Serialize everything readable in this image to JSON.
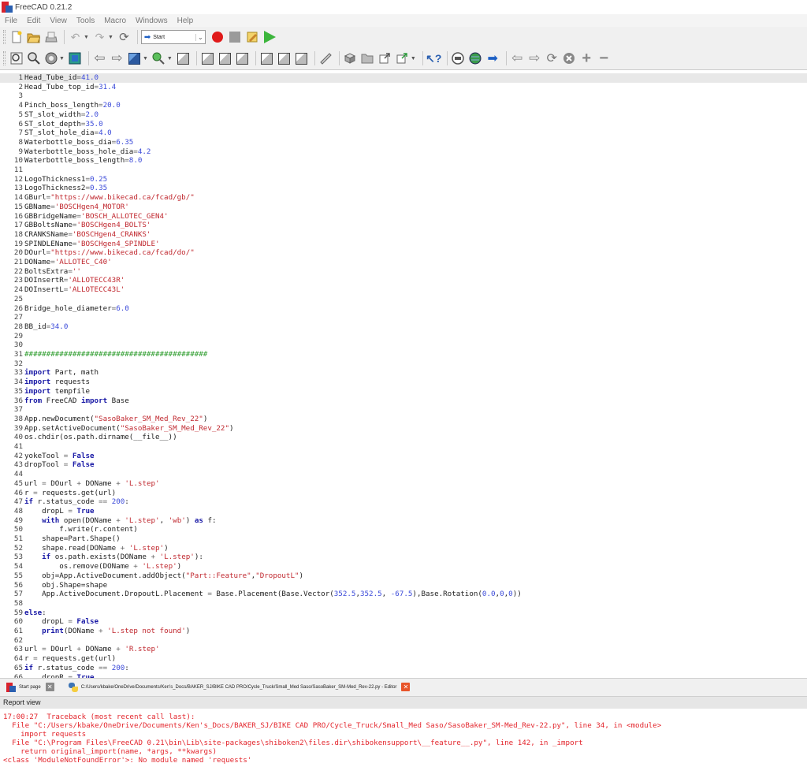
{
  "window": {
    "title": "FreeCAD 0.21.2"
  },
  "menu": [
    "File",
    "Edit",
    "View",
    "Tools",
    "Macro",
    "Windows",
    "Help"
  ],
  "workbench": {
    "selected": "Start"
  },
  "editor": {
    "current_line": 1,
    "lines": [
      [
        [
          "Head_Tube_id",
          ""
        ],
        [
          "=",
          "op"
        ],
        [
          "41.0",
          "num"
        ]
      ],
      [
        [
          "Head_Tube_top_id",
          ""
        ],
        [
          "=",
          "op"
        ],
        [
          "31.4",
          "num"
        ]
      ],
      [],
      [
        [
          "Pinch_boss_length",
          ""
        ],
        [
          "=",
          "op"
        ],
        [
          "20.0",
          "num"
        ]
      ],
      [
        [
          "ST_slot_width",
          ""
        ],
        [
          "=",
          "op"
        ],
        [
          "2.0",
          "num"
        ]
      ],
      [
        [
          "ST_slot_depth",
          ""
        ],
        [
          "=",
          "op"
        ],
        [
          "35.0",
          "num"
        ]
      ],
      [
        [
          "ST_slot_hole_dia",
          ""
        ],
        [
          "=",
          "op"
        ],
        [
          "4.0",
          "num"
        ]
      ],
      [
        [
          "Waterbottle_boss_dia",
          ""
        ],
        [
          "=",
          "op"
        ],
        [
          "6.35",
          "num"
        ]
      ],
      [
        [
          "Waterbottle_boss_hole_dia",
          ""
        ],
        [
          "=",
          "op"
        ],
        [
          "4.2",
          "num"
        ]
      ],
      [
        [
          "Waterbottle_boss_length",
          ""
        ],
        [
          "=",
          "op"
        ],
        [
          "8.0",
          "num"
        ]
      ],
      [],
      [
        [
          "LogoThickness1",
          ""
        ],
        [
          "=",
          "op"
        ],
        [
          "0.25",
          "num"
        ]
      ],
      [
        [
          "LogoThickness2",
          ""
        ],
        [
          "=",
          "op"
        ],
        [
          "0.35",
          "num"
        ]
      ],
      [
        [
          "GBurl",
          ""
        ],
        [
          "=",
          "op"
        ],
        [
          "\"https://www.bikecad.ca/fcad/gb/\"",
          "str"
        ]
      ],
      [
        [
          "GBName",
          ""
        ],
        [
          "=",
          "op"
        ],
        [
          "'BOSCHgen4_MOTOR'",
          "str"
        ]
      ],
      [
        [
          "GBBridgeName",
          ""
        ],
        [
          "=",
          "op"
        ],
        [
          "'BOSCH_ALLOTEC_GEN4'",
          "str"
        ]
      ],
      [
        [
          "GBBoltsName",
          ""
        ],
        [
          "=",
          "op"
        ],
        [
          "'BOSCHgen4_BOLTS'",
          "str"
        ]
      ],
      [
        [
          "CRANKSName",
          ""
        ],
        [
          "=",
          "op"
        ],
        [
          "'BOSCHgen4_CRANKS'",
          "str"
        ]
      ],
      [
        [
          "SPINDLEName",
          ""
        ],
        [
          "=",
          "op"
        ],
        [
          "'BOSCHgen4_SPINDLE'",
          "str"
        ]
      ],
      [
        [
          "DOurl",
          ""
        ],
        [
          "=",
          "op"
        ],
        [
          "\"https://www.bikecad.ca/fcad/do/\"",
          "str"
        ]
      ],
      [
        [
          "DOName",
          ""
        ],
        [
          "=",
          "op"
        ],
        [
          "'ALLOTEC_C40'",
          "str"
        ]
      ],
      [
        [
          "BoltsExtra",
          ""
        ],
        [
          "=",
          "op"
        ],
        [
          "''",
          "str"
        ]
      ],
      [
        [
          "DOInsertR",
          ""
        ],
        [
          "=",
          "op"
        ],
        [
          "'ALLOTECC43R'",
          "str"
        ]
      ],
      [
        [
          "DOInsertL",
          ""
        ],
        [
          "=",
          "op"
        ],
        [
          "'ALLOTECC43L'",
          "str"
        ]
      ],
      [],
      [
        [
          "Bridge_hole_diameter",
          ""
        ],
        [
          "=",
          "op"
        ],
        [
          "6.0",
          "num"
        ]
      ],
      [],
      [
        [
          "BB_id",
          ""
        ],
        [
          "=",
          "op"
        ],
        [
          "34.0",
          "num"
        ]
      ],
      [],
      [],
      [
        [
          "##########################################",
          "cmt"
        ]
      ],
      [],
      [
        [
          "import",
          "kw"
        ],
        [
          " Part, math",
          ""
        ]
      ],
      [
        [
          "import",
          "kw"
        ],
        [
          " requests",
          ""
        ]
      ],
      [
        [
          "import",
          "kw"
        ],
        [
          " tempfile",
          ""
        ]
      ],
      [
        [
          "from",
          "kw"
        ],
        [
          " FreeCAD ",
          ""
        ],
        [
          "import",
          "kw"
        ],
        [
          " Base",
          ""
        ]
      ],
      [],
      [
        [
          "App.newDocument(",
          ""
        ],
        [
          "\"SasoBaker_SM_Med_Rev_22\"",
          "str"
        ],
        [
          ")",
          ""
        ]
      ],
      [
        [
          "App.setActiveDocument(",
          ""
        ],
        [
          "\"SasoBaker_SM_Med_Rev_22\"",
          "str"
        ],
        [
          ")",
          ""
        ]
      ],
      [
        [
          "os.chdir(os.path.dirname(__file__))",
          ""
        ]
      ],
      [],
      [
        [
          "yokeTool ",
          ""
        ],
        [
          "=",
          "op"
        ],
        [
          " ",
          ""
        ],
        [
          "False",
          "kw"
        ]
      ],
      [
        [
          "dropTool ",
          ""
        ],
        [
          "=",
          "op"
        ],
        [
          " ",
          ""
        ],
        [
          "False",
          "kw"
        ]
      ],
      [],
      [
        [
          "url ",
          ""
        ],
        [
          "=",
          "op"
        ],
        [
          " DOurl ",
          ""
        ],
        [
          "+",
          "op"
        ],
        [
          " DOName ",
          ""
        ],
        [
          "+",
          "op"
        ],
        [
          " ",
          ""
        ],
        [
          "'L.step'",
          "str"
        ]
      ],
      [
        [
          "r ",
          ""
        ],
        [
          "=",
          "op"
        ],
        [
          " requests.get(url)",
          ""
        ]
      ],
      [
        [
          "if",
          "kw"
        ],
        [
          " r.status_code ",
          ""
        ],
        [
          "==",
          "op"
        ],
        [
          " ",
          ""
        ],
        [
          "200",
          "num"
        ],
        [
          ":",
          ""
        ]
      ],
      [
        [
          "    dropL ",
          ""
        ],
        [
          "=",
          "op"
        ],
        [
          " ",
          ""
        ],
        [
          "True",
          "kw"
        ]
      ],
      [
        [
          "    ",
          ""
        ],
        [
          "with",
          "kw"
        ],
        [
          " open(DOName ",
          ""
        ],
        [
          "+",
          "op"
        ],
        [
          " ",
          ""
        ],
        [
          "'L.step'",
          "str"
        ],
        [
          ", ",
          ""
        ],
        [
          "'wb'",
          "str"
        ],
        [
          ") ",
          ""
        ],
        [
          "as",
          "kw"
        ],
        [
          " f:",
          ""
        ]
      ],
      [
        [
          "        f.write(r.content)",
          ""
        ]
      ],
      [
        [
          "    shape=Part.Shape()",
          ""
        ]
      ],
      [
        [
          "    shape.read(DOName ",
          ""
        ],
        [
          "+",
          "op"
        ],
        [
          " ",
          ""
        ],
        [
          "'L.step'",
          "str"
        ],
        [
          ")",
          ""
        ]
      ],
      [
        [
          "    ",
          ""
        ],
        [
          "if",
          "kw"
        ],
        [
          " os.path.exists(DOName ",
          ""
        ],
        [
          "+",
          "op"
        ],
        [
          " ",
          ""
        ],
        [
          "'L.step'",
          "str"
        ],
        [
          "):",
          ""
        ]
      ],
      [
        [
          "        os.remove(DOName ",
          ""
        ],
        [
          "+",
          "op"
        ],
        [
          " ",
          ""
        ],
        [
          "'L.step'",
          "str"
        ],
        [
          ")",
          ""
        ]
      ],
      [
        [
          "    obj=App.ActiveDocument.addObject(",
          ""
        ],
        [
          "\"Part::Feature\"",
          "str"
        ],
        [
          ",",
          ""
        ],
        [
          "\"DropoutL\"",
          "str"
        ],
        [
          ")",
          ""
        ]
      ],
      [
        [
          "    obj.Shape=shape",
          ""
        ]
      ],
      [
        [
          "    App.ActiveDocument.DropoutL.Placement ",
          ""
        ],
        [
          "=",
          "op"
        ],
        [
          " Base.Placement(Base.Vector(",
          ""
        ],
        [
          "352.5",
          "num"
        ],
        [
          ",",
          ""
        ],
        [
          "352.5",
          "num"
        ],
        [
          ", ",
          ""
        ],
        [
          "-67.5",
          "num"
        ],
        [
          "),Base.Rotation(",
          ""
        ],
        [
          "0.0",
          "num"
        ],
        [
          ",",
          ""
        ],
        [
          "0",
          "num"
        ],
        [
          ",",
          ""
        ],
        [
          "0",
          "num"
        ],
        [
          "))",
          ""
        ]
      ],
      [],
      [
        [
          "else",
          "kw"
        ],
        [
          ":",
          ""
        ]
      ],
      [
        [
          "    dropL ",
          ""
        ],
        [
          "=",
          "op"
        ],
        [
          " ",
          ""
        ],
        [
          "False",
          "kw"
        ]
      ],
      [
        [
          "    ",
          ""
        ],
        [
          "print",
          "kw"
        ],
        [
          "(DOName ",
          ""
        ],
        [
          "+",
          "op"
        ],
        [
          " ",
          ""
        ],
        [
          "'L.step not found'",
          "str"
        ],
        [
          ")",
          ""
        ]
      ],
      [],
      [
        [
          "url ",
          ""
        ],
        [
          "=",
          "op"
        ],
        [
          " DOurl ",
          ""
        ],
        [
          "+",
          "op"
        ],
        [
          " DOName ",
          ""
        ],
        [
          "+",
          "op"
        ],
        [
          " ",
          ""
        ],
        [
          "'R.step'",
          "str"
        ]
      ],
      [
        [
          "r ",
          ""
        ],
        [
          "=",
          "op"
        ],
        [
          " requests.get(url)",
          ""
        ]
      ],
      [
        [
          "if",
          "kw"
        ],
        [
          " r.status_code ",
          ""
        ],
        [
          "==",
          "op"
        ],
        [
          " ",
          ""
        ],
        [
          "200",
          "num"
        ],
        [
          ":",
          ""
        ]
      ],
      [
        [
          "    dropR ",
          ""
        ],
        [
          "=",
          "op"
        ],
        [
          " ",
          ""
        ],
        [
          "True",
          "kw"
        ]
      ]
    ]
  },
  "tabs": [
    {
      "label": "Start page",
      "icon": "freecad-icon",
      "close": "grey"
    },
    {
      "label": "C:/Users/kbake/OneDrive/Documents/Ken's_Docs/BAKER_SJ/BIKE CAD PRO/Cycle_Truck/Small_Med Saso/SasoBaker_SM-Med_Rev-22.py - Editor",
      "icon": "python-icon",
      "close": "orange"
    }
  ],
  "report": {
    "title": "Report view",
    "lines": [
      "17:00:27  Traceback (most recent call last):",
      "  File \"C:/Users/kbake/OneDrive/Documents/Ken's_Docs/BAKER_SJ/BIKE CAD PRO/Cycle_Truck/Small_Med Saso/SasoBaker_SM-Med_Rev-22.py\", line 34, in <module>",
      "    import requests",
      "  File \"C:\\Program Files\\FreeCAD 0.21\\bin\\Lib\\site-packages\\shiboken2\\files.dir\\shibokensupport\\__feature__.py\", line 142, in _import",
      "    return original_import(name, *args, **kwargs)",
      "<class 'ModuleNotFoundError'>: No module named 'requests'"
    ]
  },
  "colors": {
    "keyword": "#1a1aa6",
    "string": "#c0282f",
    "number": "#3b4ad9",
    "comment": "#2a9b2a",
    "error": "#e3262d"
  }
}
